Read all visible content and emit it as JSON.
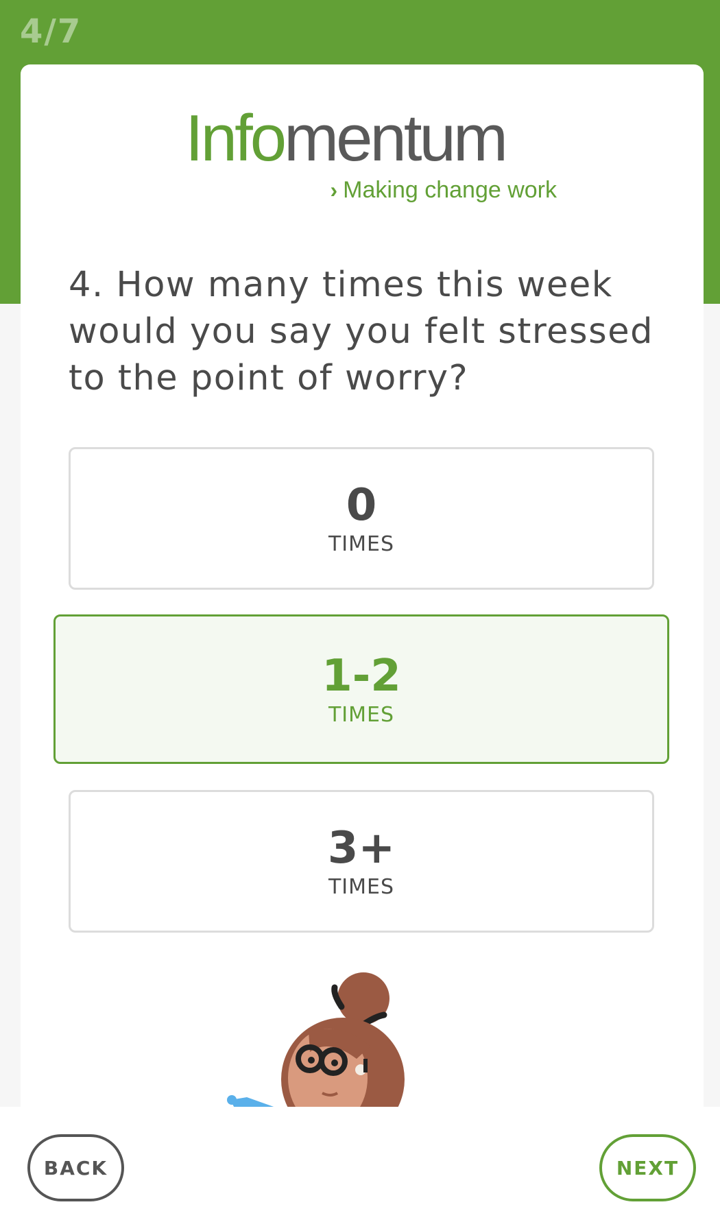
{
  "progress": {
    "label": "4/7",
    "current": 4,
    "total": 7
  },
  "logo": {
    "brand_green": "Info",
    "brand_gray": "mentum",
    "tagline_chevron": "›",
    "tagline": "Making change work"
  },
  "question": {
    "text": "4. How many times this week would you say you felt stressed to the point of worry?"
  },
  "options": [
    {
      "value": "0",
      "unit": "TIMES",
      "selected": false
    },
    {
      "value": "1-2",
      "unit": "TIMES",
      "selected": true
    },
    {
      "value": "3+",
      "unit": "TIMES",
      "selected": false
    }
  ],
  "footer": {
    "back_label": "BACK",
    "next_label": "NEXT"
  },
  "colors": {
    "brand": "#62a036",
    "text": "#4a4a4a",
    "selected_bg": "#f4f9f1",
    "border": "#dcdcdc"
  }
}
